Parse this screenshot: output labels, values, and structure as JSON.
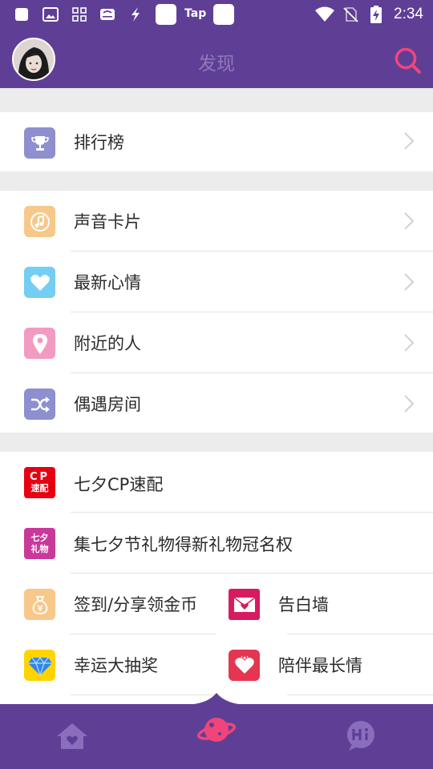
{
  "status_bar": {
    "tap_label": "Tap",
    "time": "2:34",
    "icons": [
      "app-square-icon",
      "image-icon",
      "grid-icon",
      "app-icon",
      "flash-app-icon",
      "app-square-icon",
      "app-square-icon",
      "wifi-icon",
      "no-sim-icon",
      "battery-charging-icon"
    ]
  },
  "header": {
    "title": "发现",
    "avatar_icon": "user-avatar",
    "search_icon": "search-icon"
  },
  "sections": {
    "ranking": {
      "label": "排行榜",
      "icon": "trophy-icon",
      "color": "#8e8fcf"
    },
    "voice_card": {
      "label": "声音卡片",
      "icon": "music-note-icon",
      "color": "#f7c88a"
    },
    "mood": {
      "label": "最新心情",
      "icon": "heart-icon",
      "color": "#74cdf3"
    },
    "nearby": {
      "label": "附近的人",
      "icon": "location-pin-icon",
      "color": "#f29bc0"
    },
    "encounter": {
      "label": "偶遇房间",
      "icon": "shuffle-icon",
      "color": "#8e8fcf"
    },
    "cp_match": {
      "label": "七夕CP速配",
      "icon": "cp-match-icon",
      "icon_text_top": "CP",
      "icon_text_bottom": "速配",
      "color": "#e60012"
    },
    "gift_event": {
      "label": "集七夕节礼物得新礼物冠名权",
      "icon": "qixi-gift-icon",
      "icon_text_top": "七夕",
      "icon_text_bottom": "礼物",
      "color": "#c8399a"
    },
    "checkin": {
      "label": "签到/分享领金币",
      "icon": "money-bag-icon",
      "color": "#f7c88a"
    },
    "confession": {
      "label": "告白墙",
      "icon": "love-letter-icon",
      "color": "#d81b60"
    },
    "lottery": {
      "label": "幸运大抽奖",
      "icon": "diamond-icon",
      "color": "#ffd400"
    },
    "companion": {
      "label": "陪伴最长情",
      "icon": "valentine-heart-icon",
      "color": "#e53550"
    }
  },
  "bottom_nav": {
    "items": [
      {
        "name": "home",
        "icon": "home-heart-icon",
        "active": false
      },
      {
        "name": "discover",
        "icon": "planet-icon",
        "active": true
      },
      {
        "name": "chat",
        "icon": "hi-chat-icon",
        "active": false
      }
    ],
    "active_color": "#f0457a",
    "inactive_color": "#8a6dbb"
  },
  "colors": {
    "brand_purple": "#5f3f96",
    "search_pink": "#f0457a"
  }
}
